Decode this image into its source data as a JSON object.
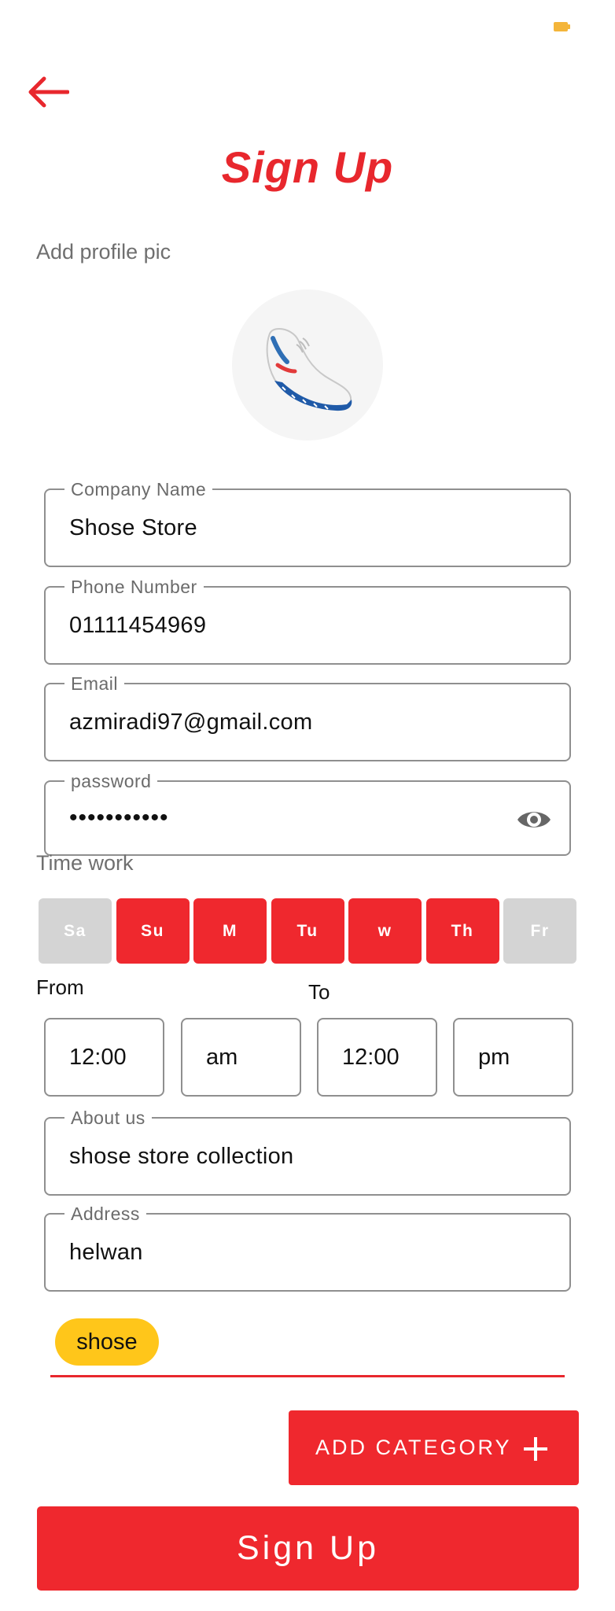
{
  "status_bar": {
    "battery_icon": "battery-icon"
  },
  "header": {
    "back_icon": "arrow-left-icon",
    "title": "Sign Up"
  },
  "profile": {
    "label": "Add profile pic",
    "image": "sneaker-photo"
  },
  "form": {
    "company": {
      "label": "Company Name",
      "value": "Shose Store"
    },
    "phone": {
      "label": "Phone Number",
      "value": "01111454969"
    },
    "email": {
      "label": "Email",
      "value": "azmiradi97@gmail.com"
    },
    "password": {
      "label": "password",
      "value": "•••••••••••",
      "toggle_icon": "eye-icon"
    },
    "about": {
      "label": "About us",
      "value": "shose store collection"
    },
    "address": {
      "label": "Address",
      "value": "helwan"
    }
  },
  "time_work": {
    "label": "Time work",
    "days": [
      {
        "label": "Sa",
        "selected": false
      },
      {
        "label": "Su",
        "selected": true
      },
      {
        "label": "M",
        "selected": true
      },
      {
        "label": "Tu",
        "selected": true
      },
      {
        "label": "w",
        "selected": true
      },
      {
        "label": "Th",
        "selected": true
      },
      {
        "label": "Fr",
        "selected": false
      }
    ],
    "from_label": "From",
    "to_label": "To",
    "from_time": "12:00",
    "from_period": "am",
    "to_time": "12:00",
    "to_period": "pm"
  },
  "categories": {
    "chips": [
      "shose"
    ],
    "add_button_label": "ADD CATEGORY",
    "add_icon": "plus-icon"
  },
  "submit_label": "Sign Up",
  "colors": {
    "accent": "#ef282e",
    "chip": "#ffc61a",
    "day_off": "#d4d4d4",
    "border": "#8f8f8f"
  }
}
